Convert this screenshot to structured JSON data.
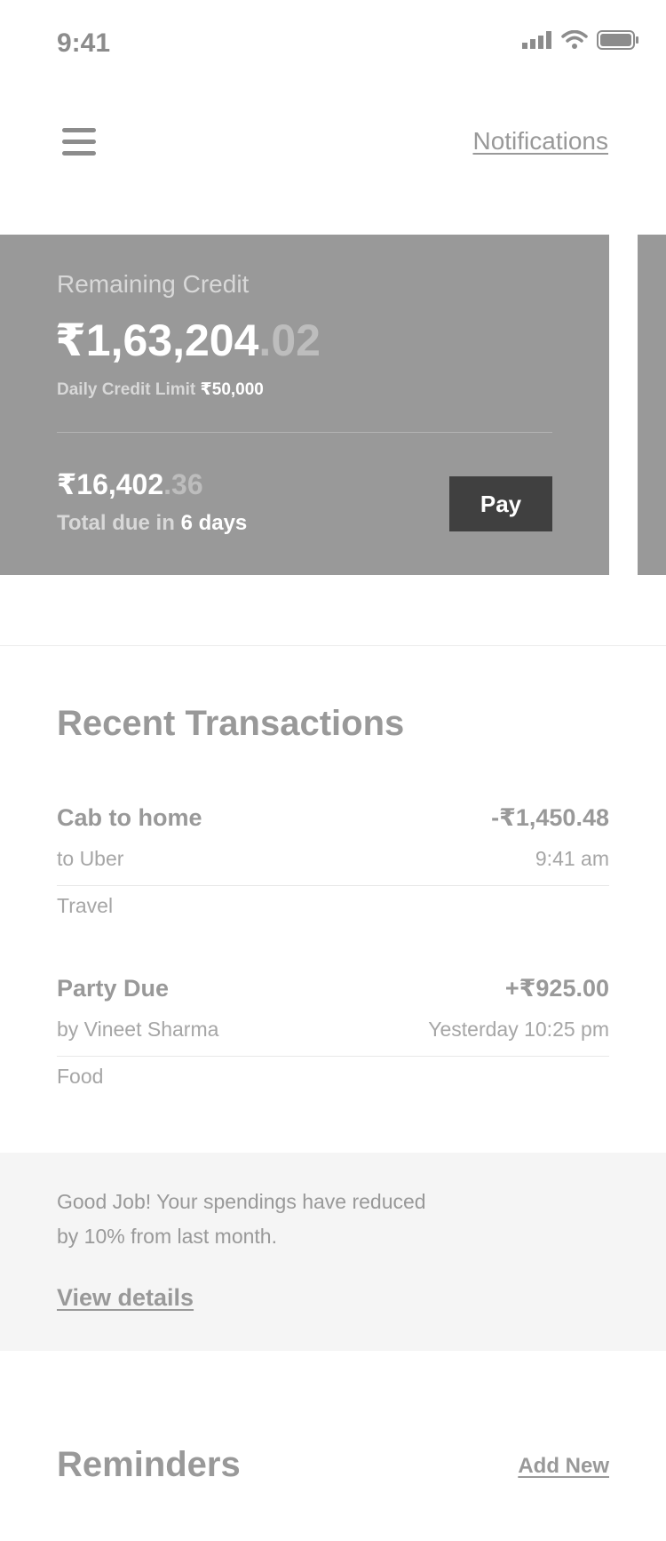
{
  "status_bar": {
    "time": "9:41",
    "icons": [
      "signal-icon",
      "wifi-icon",
      "battery-icon"
    ]
  },
  "header": {
    "menu_icon": "hamburger-menu-icon",
    "notifications_label": "Notifications"
  },
  "credit_card": {
    "remaining_label": "Remaining Credit",
    "remaining_main": "₹1,63,204",
    "remaining_decimals": ".02",
    "daily_limit_label": "Daily Credit Limit",
    "daily_limit_value": "₹50,000",
    "due_main": "₹16,402",
    "due_decimals": ".36",
    "due_prefix": "Total due in",
    "due_days": "6 days",
    "pay_label": "Pay"
  },
  "transactions": {
    "title": "Recent Transactions",
    "items": [
      {
        "title": "Cab to home",
        "amount": "-₹1,450.48",
        "sub": "to Uber",
        "time": "9:41 am",
        "category": "Travel"
      },
      {
        "title": "Party Due",
        "amount": "+₹925.00",
        "sub": "by Vineet Sharma",
        "time": "Yesterday 10:25 pm",
        "category": "Food"
      }
    ]
  },
  "banner": {
    "message": "Good Job! Your spendings have reduced by 10% from last month.",
    "link_label": "View details"
  },
  "reminders": {
    "title": "Reminders",
    "add_label": "Add New"
  },
  "colors": {
    "card_background": "#999999",
    "pay_button": "#404040",
    "banner_background": "#f5f5f5",
    "text_gray": "#999999"
  }
}
